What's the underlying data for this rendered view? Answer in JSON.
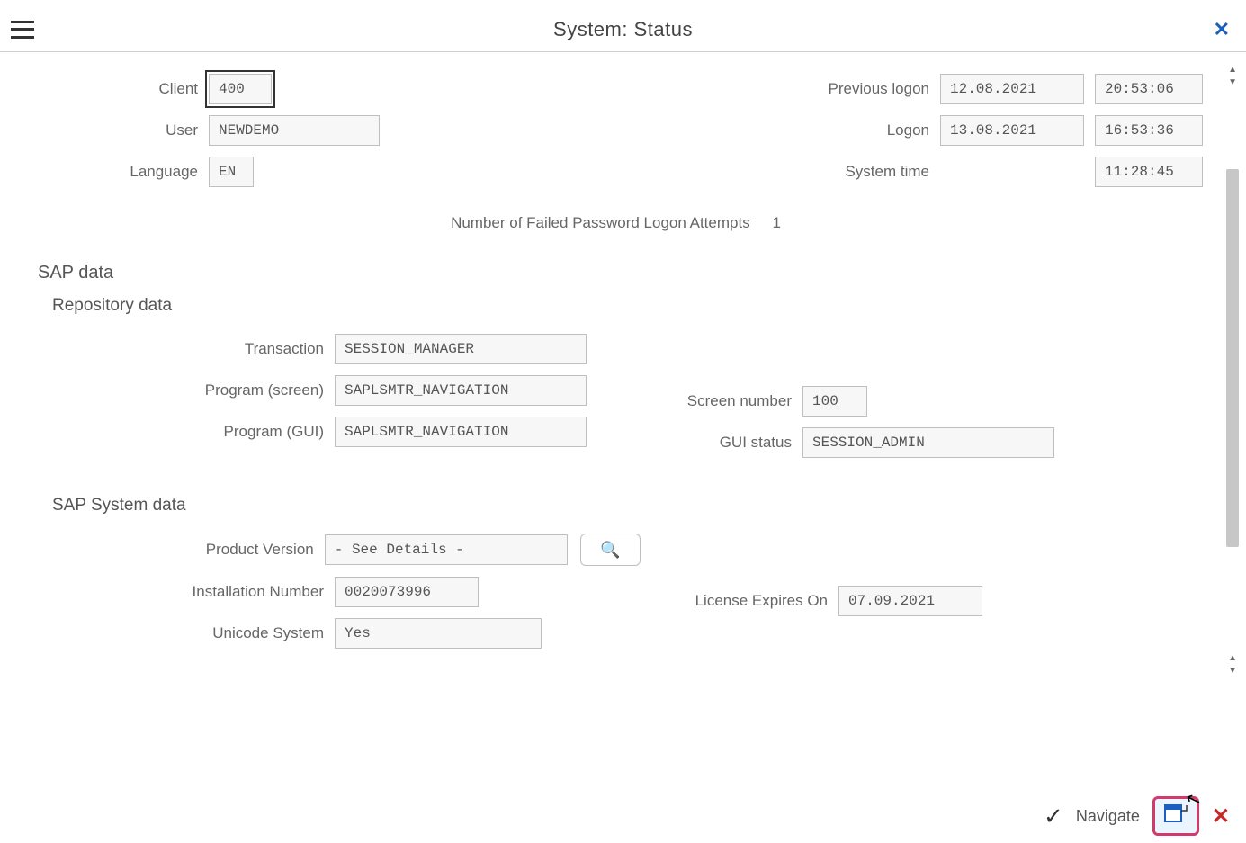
{
  "header": {
    "title": "System: Status"
  },
  "usage": {
    "client_label": "Client",
    "client": "400",
    "user_label": "User",
    "user": "NEWDEMO",
    "language_label": "Language",
    "language": "EN",
    "previous_logon_label": "Previous logon",
    "previous_logon_date": "12.08.2021",
    "previous_logon_time": "20:53:06",
    "logon_label": "Logon",
    "logon_date": "13.08.2021",
    "logon_time": "16:53:36",
    "system_time_label": "System time",
    "system_time": "11:28:45",
    "failed_attempts_label": "Number of Failed Password Logon Attempts",
    "failed_attempts": "1"
  },
  "sap": {
    "data_title": "SAP data",
    "repo_title": "Repository data",
    "transaction_label": "Transaction",
    "transaction": "SESSION_MANAGER",
    "program_screen_label": "Program (screen)",
    "program_screen": "SAPLSMTR_NAVIGATION",
    "screen_number_label": "Screen number",
    "screen_number": "100",
    "program_gui_label": "Program (GUI)",
    "program_gui": "SAPLSMTR_NAVIGATION",
    "gui_status_label": "GUI status",
    "gui_status": "SESSION_ADMIN",
    "sys_title": "SAP System data",
    "product_version_label": "Product Version",
    "product_version": "- See Details -",
    "installation_number_label": "Installation Number",
    "installation_number": "0020073996",
    "license_expires_label": "License Expires On",
    "license_expires": "07.09.2021",
    "unicode_label": "Unicode System",
    "unicode": "Yes"
  },
  "footer": {
    "navigate_label": "Navigate"
  }
}
